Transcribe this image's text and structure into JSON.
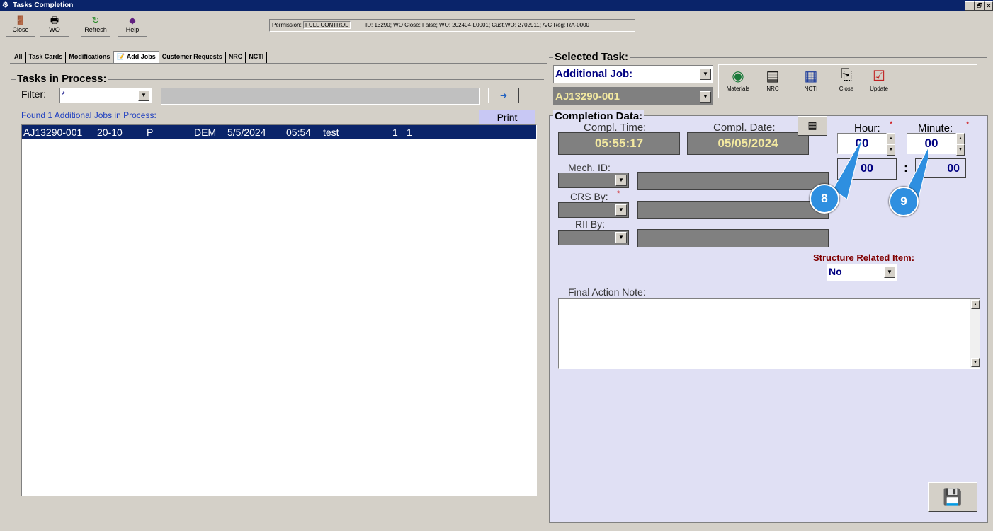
{
  "window": {
    "title": "Tasks Completion",
    "controls": [
      "_",
      "🗗",
      "×"
    ]
  },
  "toolbar": {
    "buttons": [
      {
        "label": "Close",
        "icon": "close-door-icon"
      },
      {
        "label": "WO",
        "icon": "printer-icon"
      },
      {
        "label": "Refresh",
        "icon": "refresh-icon"
      },
      {
        "label": "Help",
        "icon": "help-icon"
      }
    ],
    "permission_label": "Permission:",
    "permission_value": "FULL CONTROL",
    "info": "ID: 13290; WO Close: False; WO: 202404-L0001; Cust.WO: 2702911; A/C Reg: RA-0000"
  },
  "tabs": [
    "All",
    "Task Cards",
    "Modifications",
    "Add Jobs",
    "Customer Requests",
    "NRC",
    "NCTI"
  ],
  "active_tab": "Add Jobs",
  "left": {
    "group_title": "Tasks in Process:",
    "filter_label": "Filter:",
    "filter_value": "*",
    "found_text": "Found 1 Additional Jobs in Process:",
    "print_label": "Print",
    "rows": [
      {
        "id": "AJ13290-001",
        "ata": "20-10",
        "status": "P",
        "user": "DEM",
        "date": "5/5/2024",
        "time": "05:54",
        "desc": "test",
        "a": "1",
        "b": "1"
      }
    ]
  },
  "selected": {
    "group_title": "Selected Task:",
    "type_value": "Additional Job:",
    "task_value": "AJ13290-001",
    "buttons": [
      {
        "label": "Materials",
        "icon": "globe-icon"
      },
      {
        "label": "NRC",
        "icon": "document-icon"
      },
      {
        "label": "NCTI",
        "icon": "grid-icon"
      },
      {
        "label": "Close",
        "icon": "close-task-icon"
      },
      {
        "label": "Update",
        "icon": "checklist-icon"
      }
    ]
  },
  "completion": {
    "group_title": "Completion Data:",
    "compl_time_label": "Compl. Time:",
    "compl_time_value": "05:55:17",
    "compl_date_label": "Compl. Date:",
    "compl_date_value": "05/05/2024",
    "hour_label": "Hour:",
    "hour_value": "00",
    "minute_label": "Minute:",
    "minute_value": "00",
    "hour_display": "00",
    "minute_display": "00",
    "colon": ":",
    "required_mark": "*",
    "mech_label": "Mech. ID:",
    "crs_label": "CRS By:",
    "rii_label": "RII By:",
    "structure_label": "Structure Related Item:",
    "structure_value": "No",
    "final_note_label": "Final Action Note:",
    "callouts": [
      "8",
      "9"
    ]
  },
  "colors": {
    "title_bar": "#0a246a",
    "selection": "#0a246a",
    "field_value": "#000080",
    "panel": "#e0e0f4",
    "callout": "#2e8fe0",
    "required": "#cc0000",
    "structure_label": "#800000"
  }
}
